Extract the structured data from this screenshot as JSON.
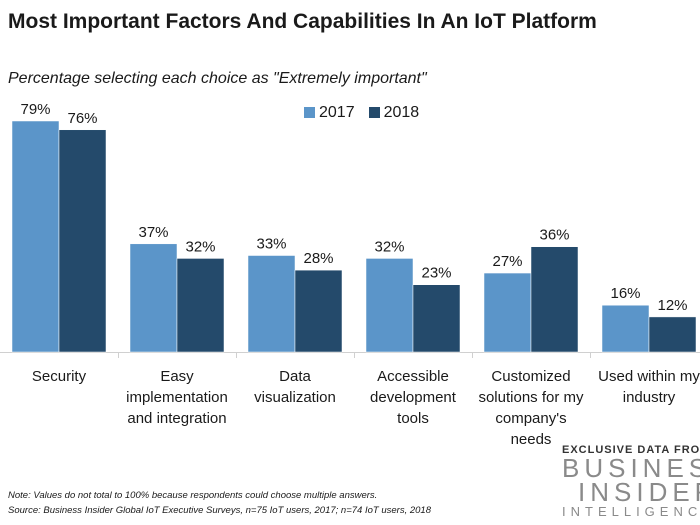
{
  "chart_data": {
    "type": "bar",
    "title": "Most Important Factors And Capabilities In An IoT Platform",
    "subtitle": "Percentage selecting each choice as \"Extremely important\"",
    "categories": [
      "Security",
      "Easy implementation and integration",
      "Data visualization",
      "Accessible development tools",
      "Customized solutions for my company's needs",
      "Used within my industry"
    ],
    "category_lines": [
      [
        "Security"
      ],
      [
        "Easy",
        "implementation",
        "and integration"
      ],
      [
        "Data",
        "visualization"
      ],
      [
        "Accessible",
        "development",
        "tools"
      ],
      [
        "Customized",
        "solutions for my",
        "company's",
        "needs"
      ],
      [
        "Used within my",
        "industry"
      ]
    ],
    "series": [
      {
        "name": "2017",
        "color": "#5b95c9",
        "values": [
          79,
          37,
          33,
          32,
          27,
          16
        ]
      },
      {
        "name": "2018",
        "color": "#244a6b",
        "values": [
          76,
          32,
          28,
          23,
          36,
          12
        ]
      }
    ],
    "value_suffix": "%",
    "ylim": [
      0,
      80
    ],
    "grid": false,
    "legend": "top-center"
  },
  "note": "Note: Values do not total to 100% because respondents could choose multiple answers.",
  "source": "Source: Business Insider Global IoT Executive Surveys, n=75 IoT users, 2017; n=74 IoT users, 2018",
  "logo": {
    "exclusive": "EXCLUSIVE DATA FROM",
    "line1": "BUSINESS",
    "line2": "INSIDER",
    "line3": "INTELLIGENCE"
  }
}
